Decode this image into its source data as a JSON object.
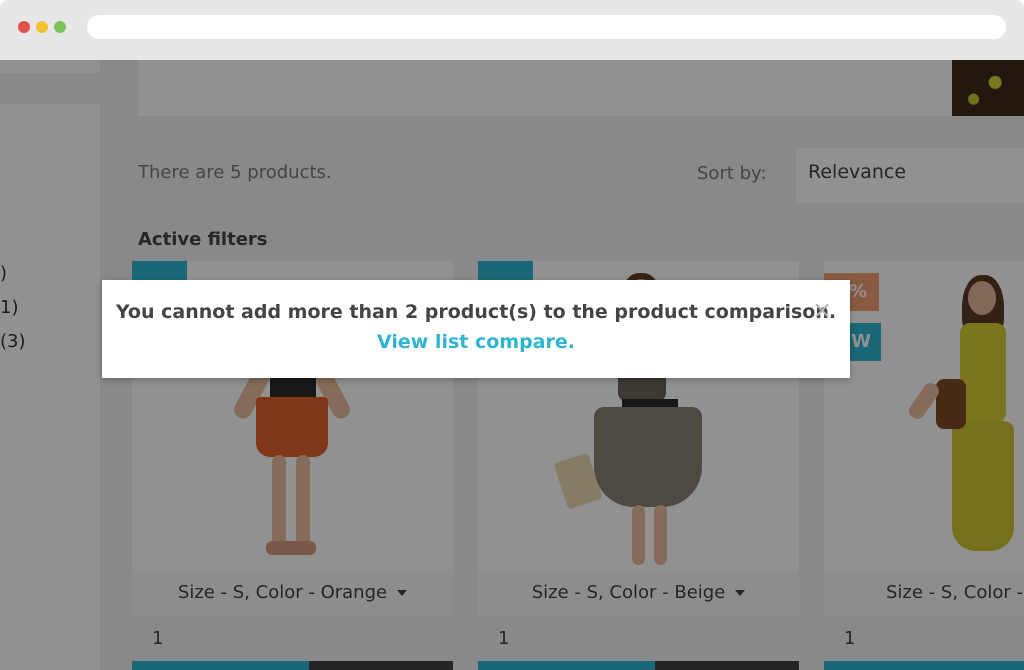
{
  "modal": {
    "message": "You cannot add more than 2 product(s) to the product comparison.",
    "link_text": "View list compare.",
    "close_glyph": "×"
  },
  "listing": {
    "count_text": "There are 5 products.",
    "sort_label": "Sort by:",
    "sort_value": "Relevance",
    "active_filters": "Active filters"
  },
  "facets": [
    ")",
    "1)",
    "(3)"
  ],
  "products": [
    {
      "variant": "Size - S, Color - Orange",
      "quantity": "1"
    },
    {
      "variant": "Size - S, Color - Beige",
      "quantity": "1"
    },
    {
      "variant": "Size - S, Color - Ye",
      "quantity": "1",
      "flags": [
        "%",
        "W"
      ]
    }
  ],
  "colors": {
    "accent": "#2fb5d2",
    "discount_flag": "#f39d72",
    "dark_button": "#414141"
  }
}
